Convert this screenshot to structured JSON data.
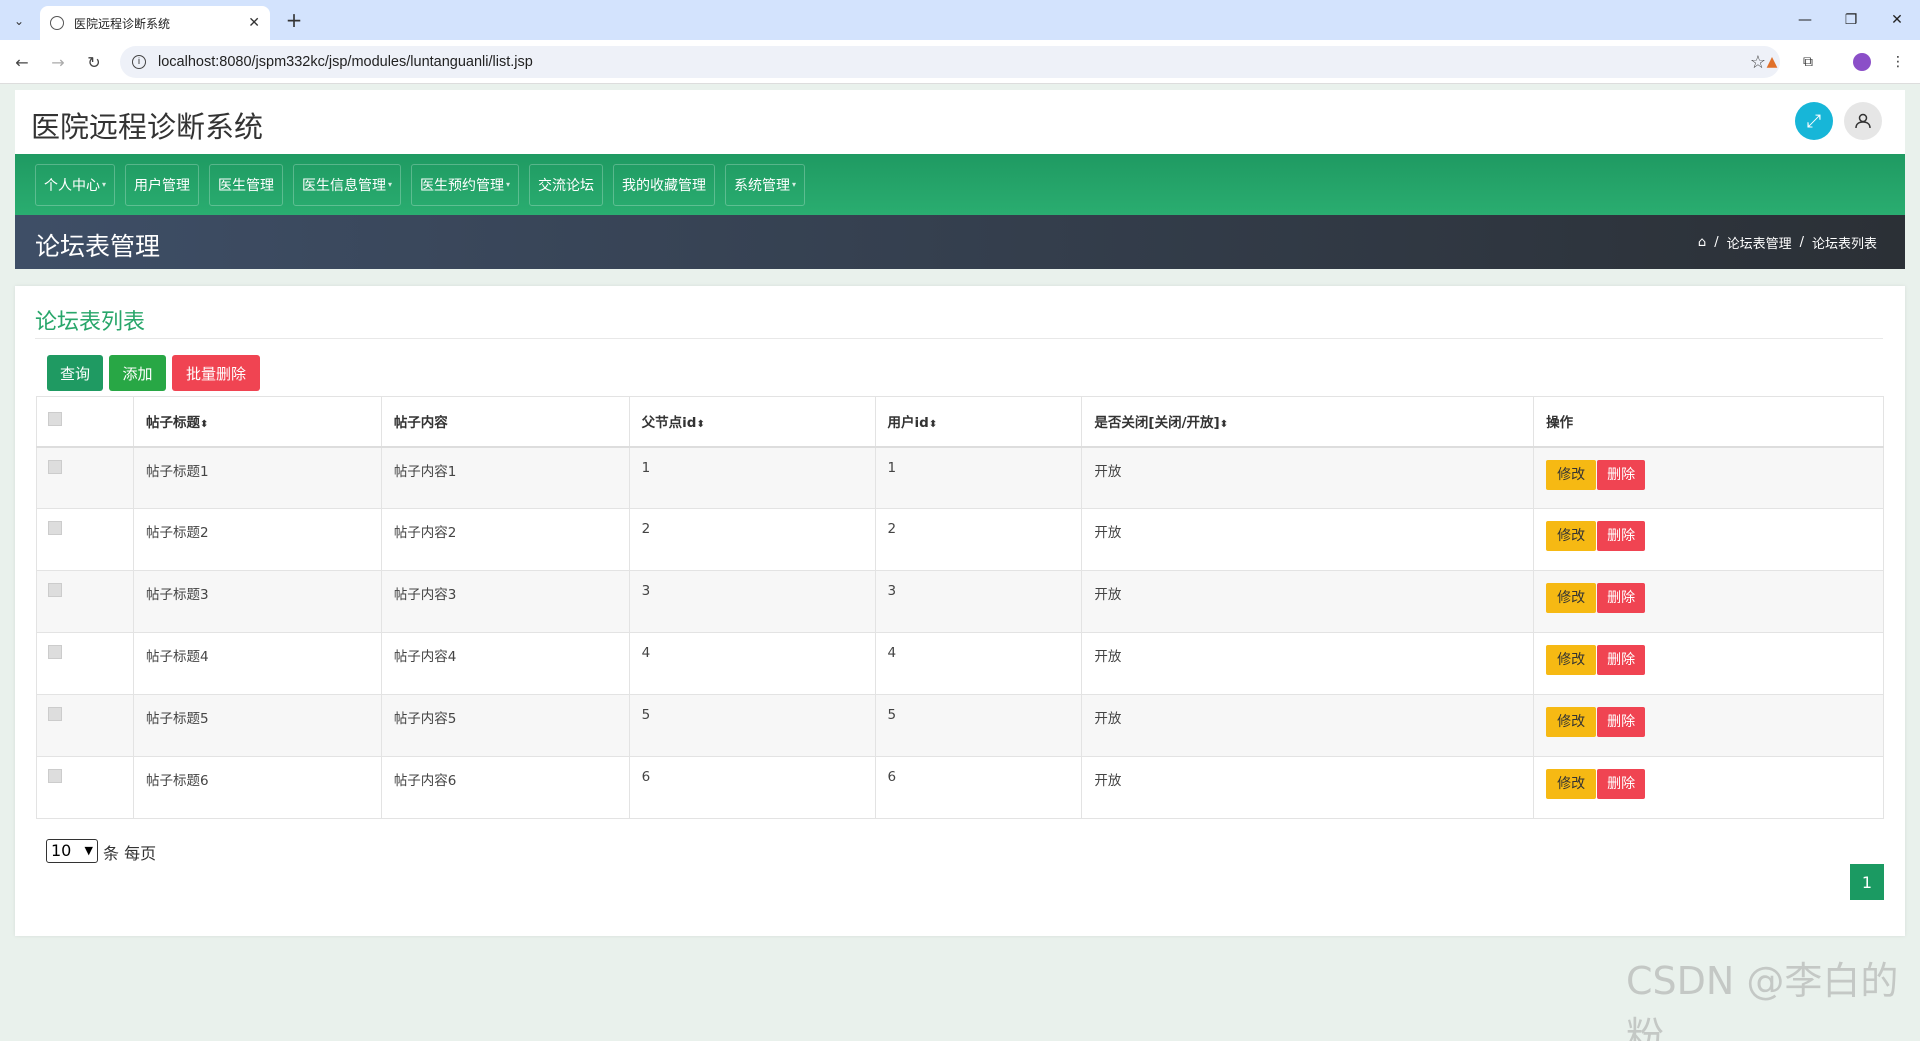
{
  "browser": {
    "tab_title": "医院远程诊断系统",
    "url": "localhost:8080/jspm332kc/jsp/modules/luntanguanli/list.jsp"
  },
  "app": {
    "title": "医院远程诊断系统",
    "menu": [
      "个人中心",
      "用户管理",
      "医生管理",
      "医生信息管理",
      "医生预约管理",
      "交流论坛",
      "我的收藏管理",
      "系统管理"
    ],
    "page_title": "论坛表管理",
    "breadcrumb": [
      "论坛表管理",
      "论坛表列表"
    ]
  },
  "card": {
    "title": "论坛表列表",
    "buttons": {
      "query": "查询",
      "add": "添加",
      "batch_delete": "批量删除"
    }
  },
  "table": {
    "headers": [
      "帖子标题",
      "帖子内容",
      "父节点id",
      "用户id",
      "是否关闭[关闭/开放]",
      "操作"
    ],
    "rows": [
      {
        "title": "帖子标题1",
        "content": "帖子内容1",
        "parentid": "1",
        "userid": "1",
        "status": "开放"
      },
      {
        "title": "帖子标题2",
        "content": "帖子内容2",
        "parentid": "2",
        "userid": "2",
        "status": "开放"
      },
      {
        "title": "帖子标题3",
        "content": "帖子内容3",
        "parentid": "3",
        "userid": "3",
        "status": "开放"
      },
      {
        "title": "帖子标题4",
        "content": "帖子内容4",
        "parentid": "4",
        "userid": "4",
        "status": "开放"
      },
      {
        "title": "帖子标题5",
        "content": "帖子内容5",
        "parentid": "5",
        "userid": "5",
        "status": "开放"
      },
      {
        "title": "帖子标题6",
        "content": "帖子内容6",
        "parentid": "6",
        "userid": "6",
        "status": "开放"
      }
    ],
    "edit_label": "修改",
    "delete_label": "删除"
  },
  "pager": {
    "page_size": "10",
    "per_page_text": "条 每页",
    "current_page": "1"
  },
  "watermark": "CSDN @李白的粉",
  "colors": {
    "primary": "#1f9a62",
    "warning": "#f6b913",
    "danger": "#f04452",
    "info": "#17b6d8"
  }
}
